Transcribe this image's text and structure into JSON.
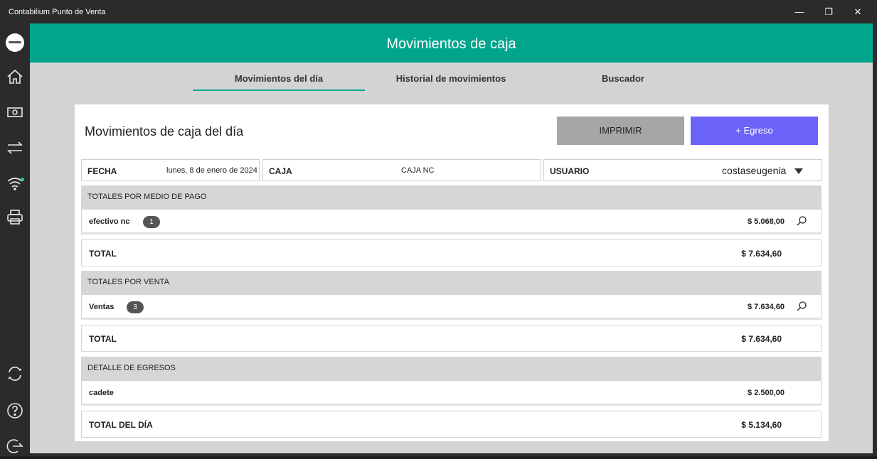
{
  "window": {
    "title": "Contabilium Punto de Venta",
    "minimize": "—",
    "restore": "❐",
    "close": "✕"
  },
  "header": {
    "title": "Movimientos de caja"
  },
  "tabs": [
    {
      "label": "Movimientos del día",
      "active": true
    },
    {
      "label": "Historial de movimientos",
      "active": false
    },
    {
      "label": "Buscador",
      "active": false
    }
  ],
  "card": {
    "title": "Movimientos de caja del día",
    "print_label": "IMPRIMIR",
    "egreso_label": "+ Egreso"
  },
  "filters": {
    "fecha_label": "FECHA",
    "fecha_value": "lunes, 8 de enero de 2024",
    "caja_label": "CAJA",
    "caja_value": "CAJA NC",
    "usuario_label": "USUARIO",
    "usuario_value": "costaseugenia"
  },
  "medio_pago": {
    "heading": "TOTALES POR MEDIO DE PAGO",
    "items": [
      {
        "name": "efectivo nc",
        "count": "1",
        "amount": "$ 5.068,00"
      }
    ],
    "total_label": "TOTAL",
    "total_value": "$ 7.634,60"
  },
  "venta": {
    "heading": "TOTALES POR VENTA",
    "items": [
      {
        "name": "Ventas",
        "count": "3",
        "amount": "$ 7.634,60"
      }
    ],
    "total_label": "TOTAL",
    "total_value": "$ 7.634,60"
  },
  "egresos": {
    "heading": "DETALLE DE EGRESOS",
    "items": [
      {
        "name": "cadete",
        "amount": "$ 2.500,00"
      }
    ],
    "total_label": "TOTAL DEL DÍA",
    "total_value": "$ 5.134,60"
  },
  "colors": {
    "accent": "#00a58c",
    "primary_button": "#6b63f7",
    "print_button": "#a6a6a6"
  },
  "icons": [
    "home-icon",
    "cash-icon",
    "transfer-icon",
    "wifi-icon",
    "printer-icon",
    "sync-icon",
    "help-icon",
    "logout-icon",
    "search-icon",
    "caret-down-icon"
  ]
}
